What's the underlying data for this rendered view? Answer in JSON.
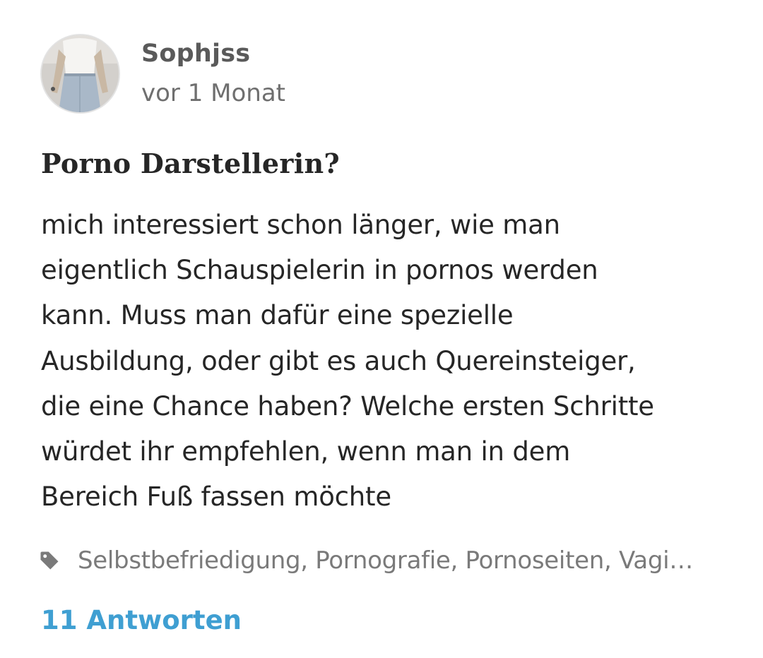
{
  "post": {
    "author": {
      "name": "Sophjss",
      "avatar_icon": "user-avatar-photo"
    },
    "timestamp": "vor 1 Monat",
    "title": "Porno Darstellerin?",
    "body_lines": [
      "mich interessiert schon länger, wie man",
      "eigentlich Schauspielerin in pornos werden",
      "kann. Muss man dafür eine spezielle",
      "Ausbildung, oder gibt es auch Quereinsteiger,",
      "die eine Chance haben? Welche ersten Schritte",
      "würdet ihr empfehlen, wenn man in dem",
      "Bereich Fuß fassen möchte"
    ],
    "tags": {
      "icon": "tag-icon",
      "text": "Selbstbefriedigung, Pornografie, Pornoseiten, Vagi…"
    },
    "answers_label": "11 Antworten"
  },
  "colors": {
    "link": "#3f9fd2",
    "author": "#5a5a5a",
    "meta": "#6f6f6f",
    "text": "#262626",
    "tags": "#7a7a7a"
  }
}
